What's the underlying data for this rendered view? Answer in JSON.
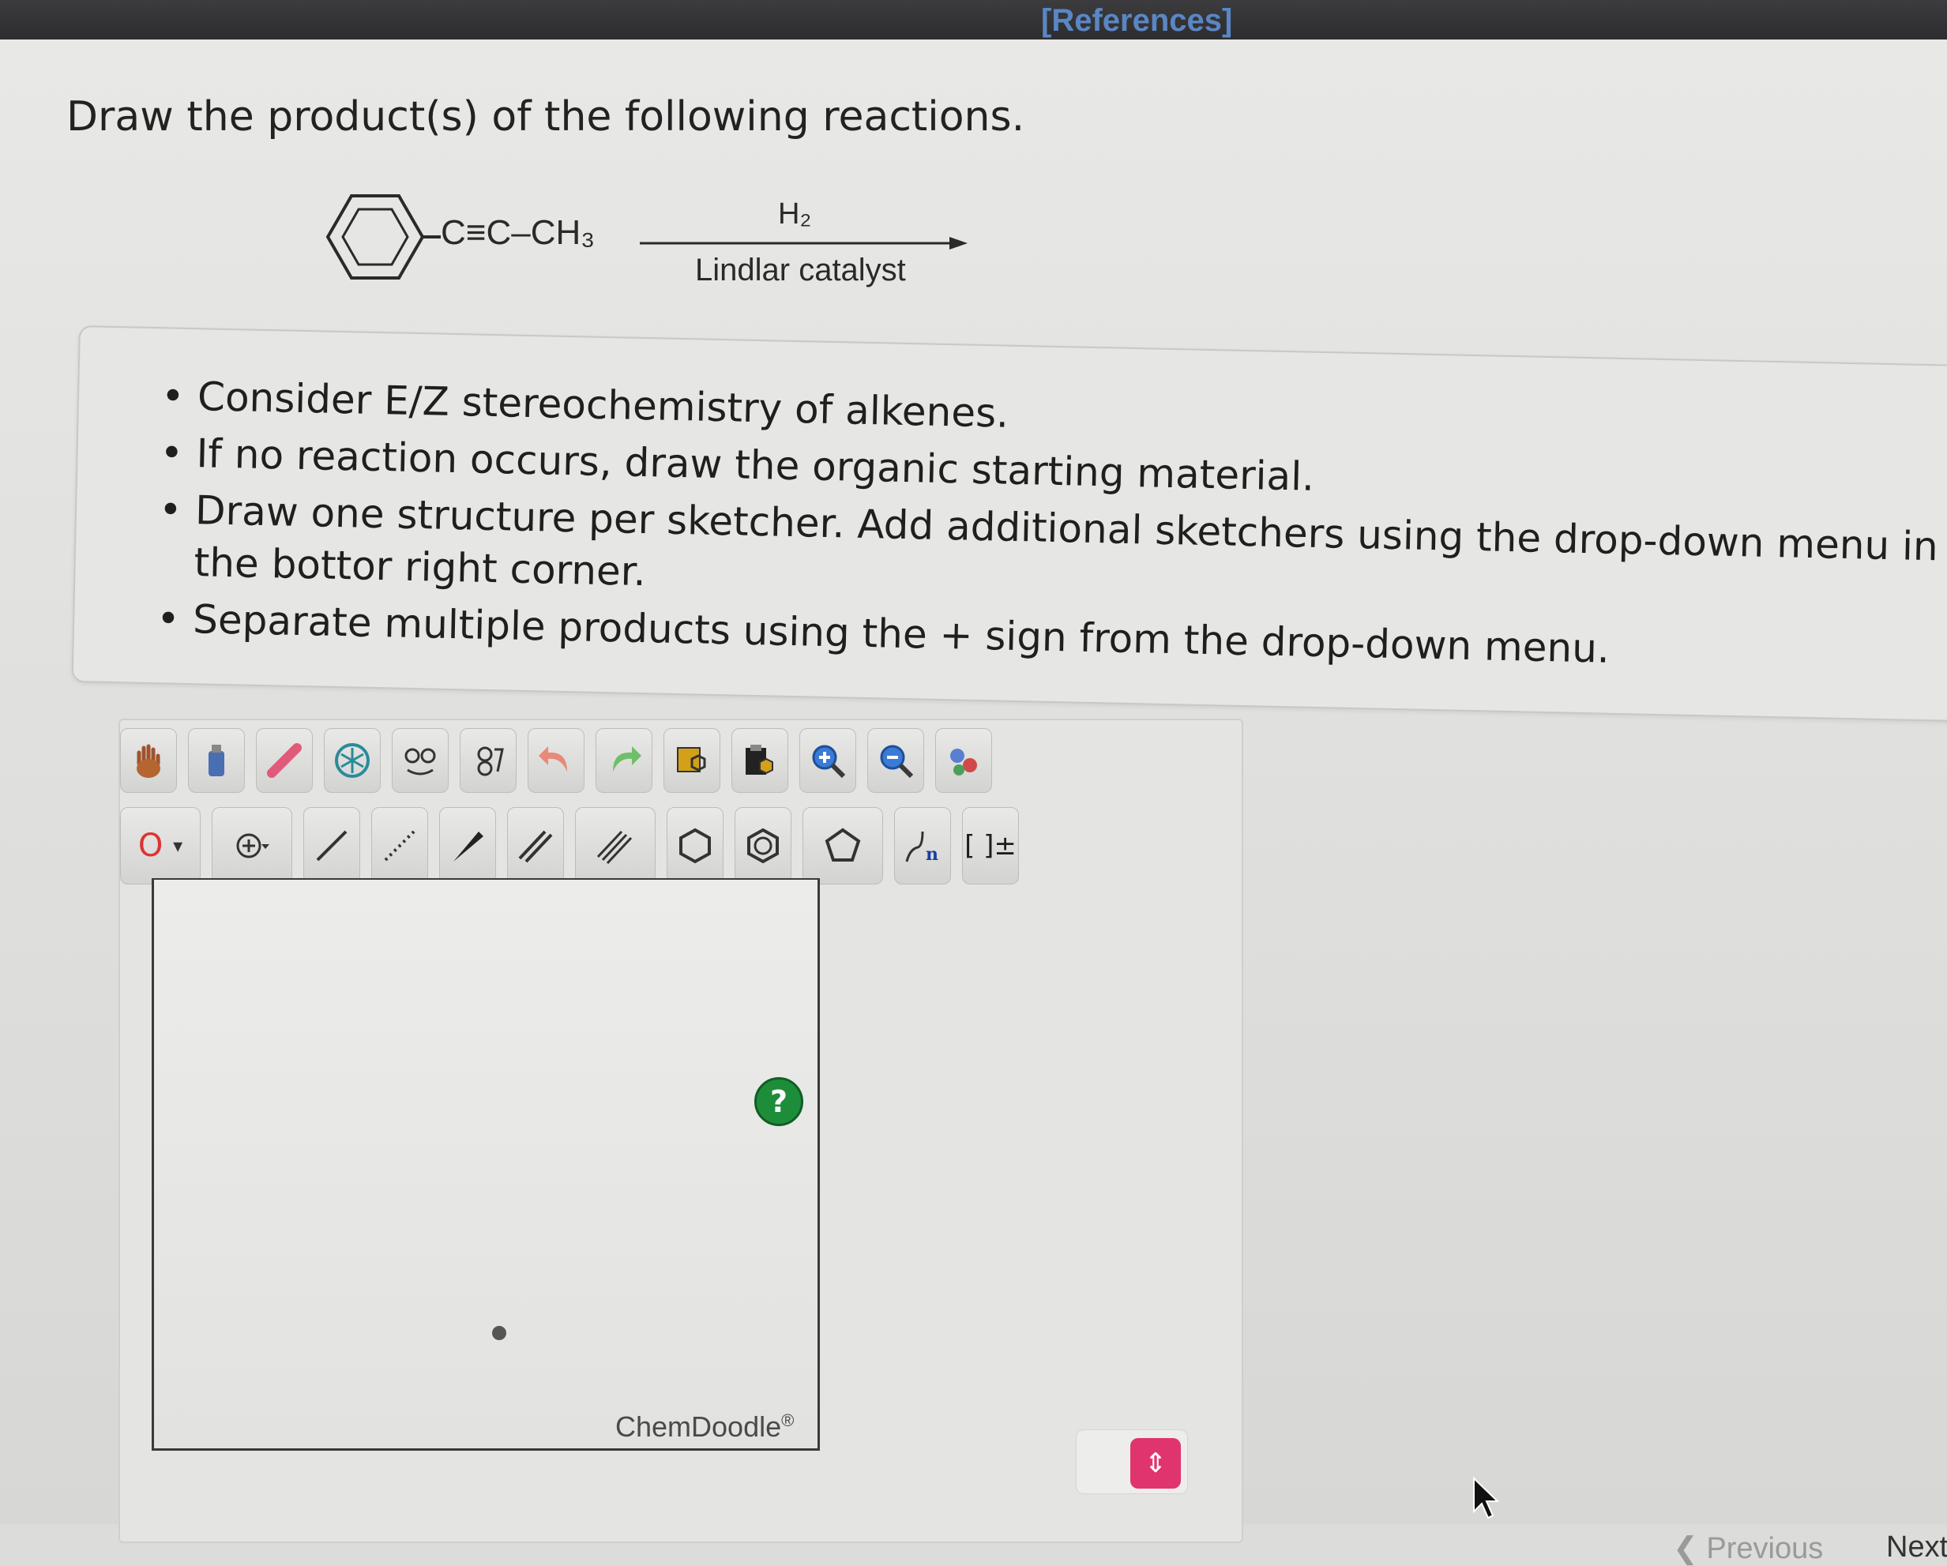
{
  "header": {
    "references_label": "[References]"
  },
  "question": {
    "prompt": "Draw the product(s) of the following reactions."
  },
  "reaction": {
    "reactant": "C≡C–CH₃",
    "reagent_top": "H₂",
    "reagent_bottom": "Lindlar catalyst"
  },
  "instructions": {
    "items": [
      "Consider E/Z stereochemistry of alkenes.",
      "If no reaction occurs, draw the organic starting material.",
      "Draw one structure per sketcher. Add additional sketchers using the drop-down menu in the bottor right corner.",
      "Separate multiple products using the + sign from the drop-down menu."
    ]
  },
  "sketcher": {
    "brand": "ChemDoodle",
    "help_symbol": "?",
    "atom_label": "O",
    "bracket_label": "[ ]±",
    "toolbar_row1": [
      "hand-icon",
      "lasso-icon",
      "eraser-icon",
      "clean-icon",
      "ring-template-icon",
      "atom-map-icon",
      "undo-icon",
      "redo-icon",
      "copy-icon",
      "paste-icon",
      "zoom-in-icon",
      "zoom-out-icon",
      "3d-icon"
    ],
    "toolbar_row2": [
      "atom-o-icon",
      "charge-plus-icon",
      "single-bond-icon",
      "dashed-bond-icon",
      "wedge-bond-icon",
      "double-bond-icon",
      "triple-bond-icon",
      "hexagon-icon",
      "benzene-icon",
      "pentagon-icon",
      "polymer-icon",
      "bracket-icon"
    ]
  },
  "navigation": {
    "previous": "Previous",
    "next": "Next"
  },
  "colors": {
    "accent_link": "#5b86c4",
    "help_green": "#1e8d3a",
    "dropdown_pink": "#e0346e"
  }
}
